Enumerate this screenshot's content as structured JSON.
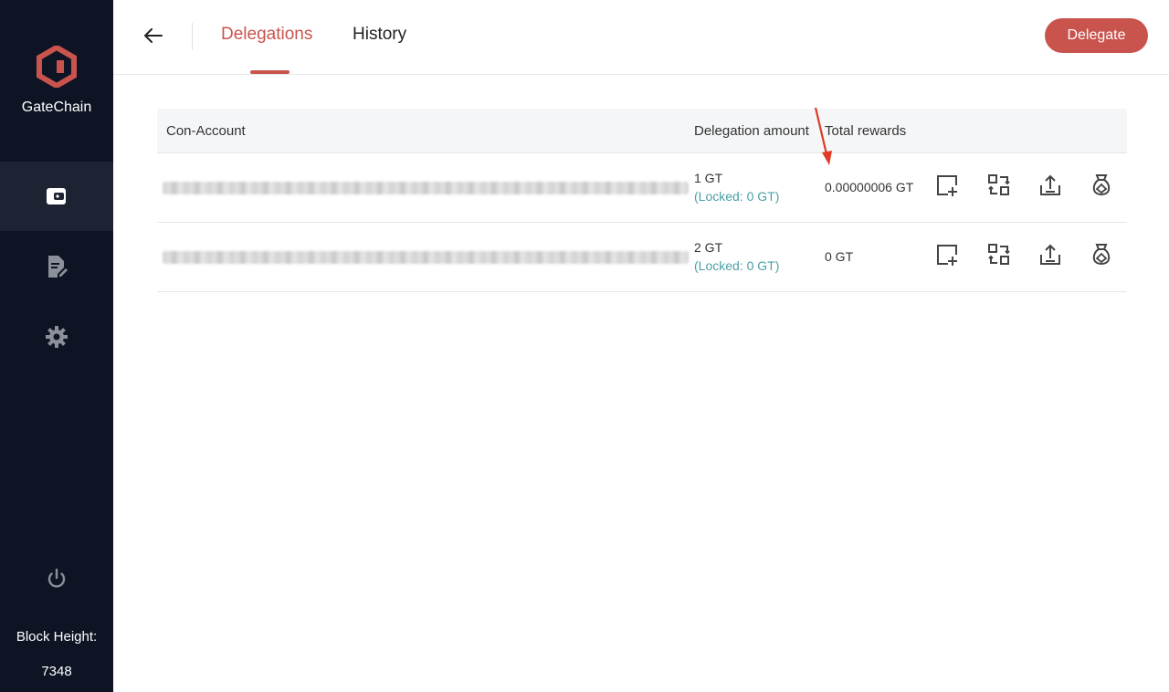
{
  "sidebar": {
    "brand_name": "GateChain",
    "nav": [
      {
        "icon": "wallet-icon",
        "active": true
      },
      {
        "icon": "document-edit-icon",
        "active": false
      },
      {
        "icon": "gear-icon",
        "active": false
      }
    ],
    "power_icon": "power-icon",
    "block_height_label": "Block Height:",
    "block_height_value": "7348",
    "colors": {
      "background": "#0e1424",
      "active": "#1d2333",
      "logo": "#c9544e"
    }
  },
  "header": {
    "back_icon": "arrow-left-icon",
    "tabs": [
      {
        "label": "Delegations",
        "active": true
      },
      {
        "label": "History",
        "active": false
      }
    ],
    "delegate_button": "Delegate",
    "accent_color": "#c9544e"
  },
  "table": {
    "columns": [
      "Con-Account",
      "Delegation amount",
      "Total rewards"
    ],
    "rows": [
      {
        "account": "",
        "amount": "1 GT",
        "locked": "(Locked: 0 GT)",
        "reward": "0.00000006 GT"
      },
      {
        "account": "",
        "amount": "2 GT",
        "locked": "(Locked: 0 GT)",
        "reward": "0 GT"
      }
    ],
    "actions": [
      "add-delegation-icon",
      "redelegate-swap-icon",
      "undelegate-upload-icon",
      "withdraw-rewards-bag-icon"
    ],
    "locked_color": "#4b9fa7"
  }
}
